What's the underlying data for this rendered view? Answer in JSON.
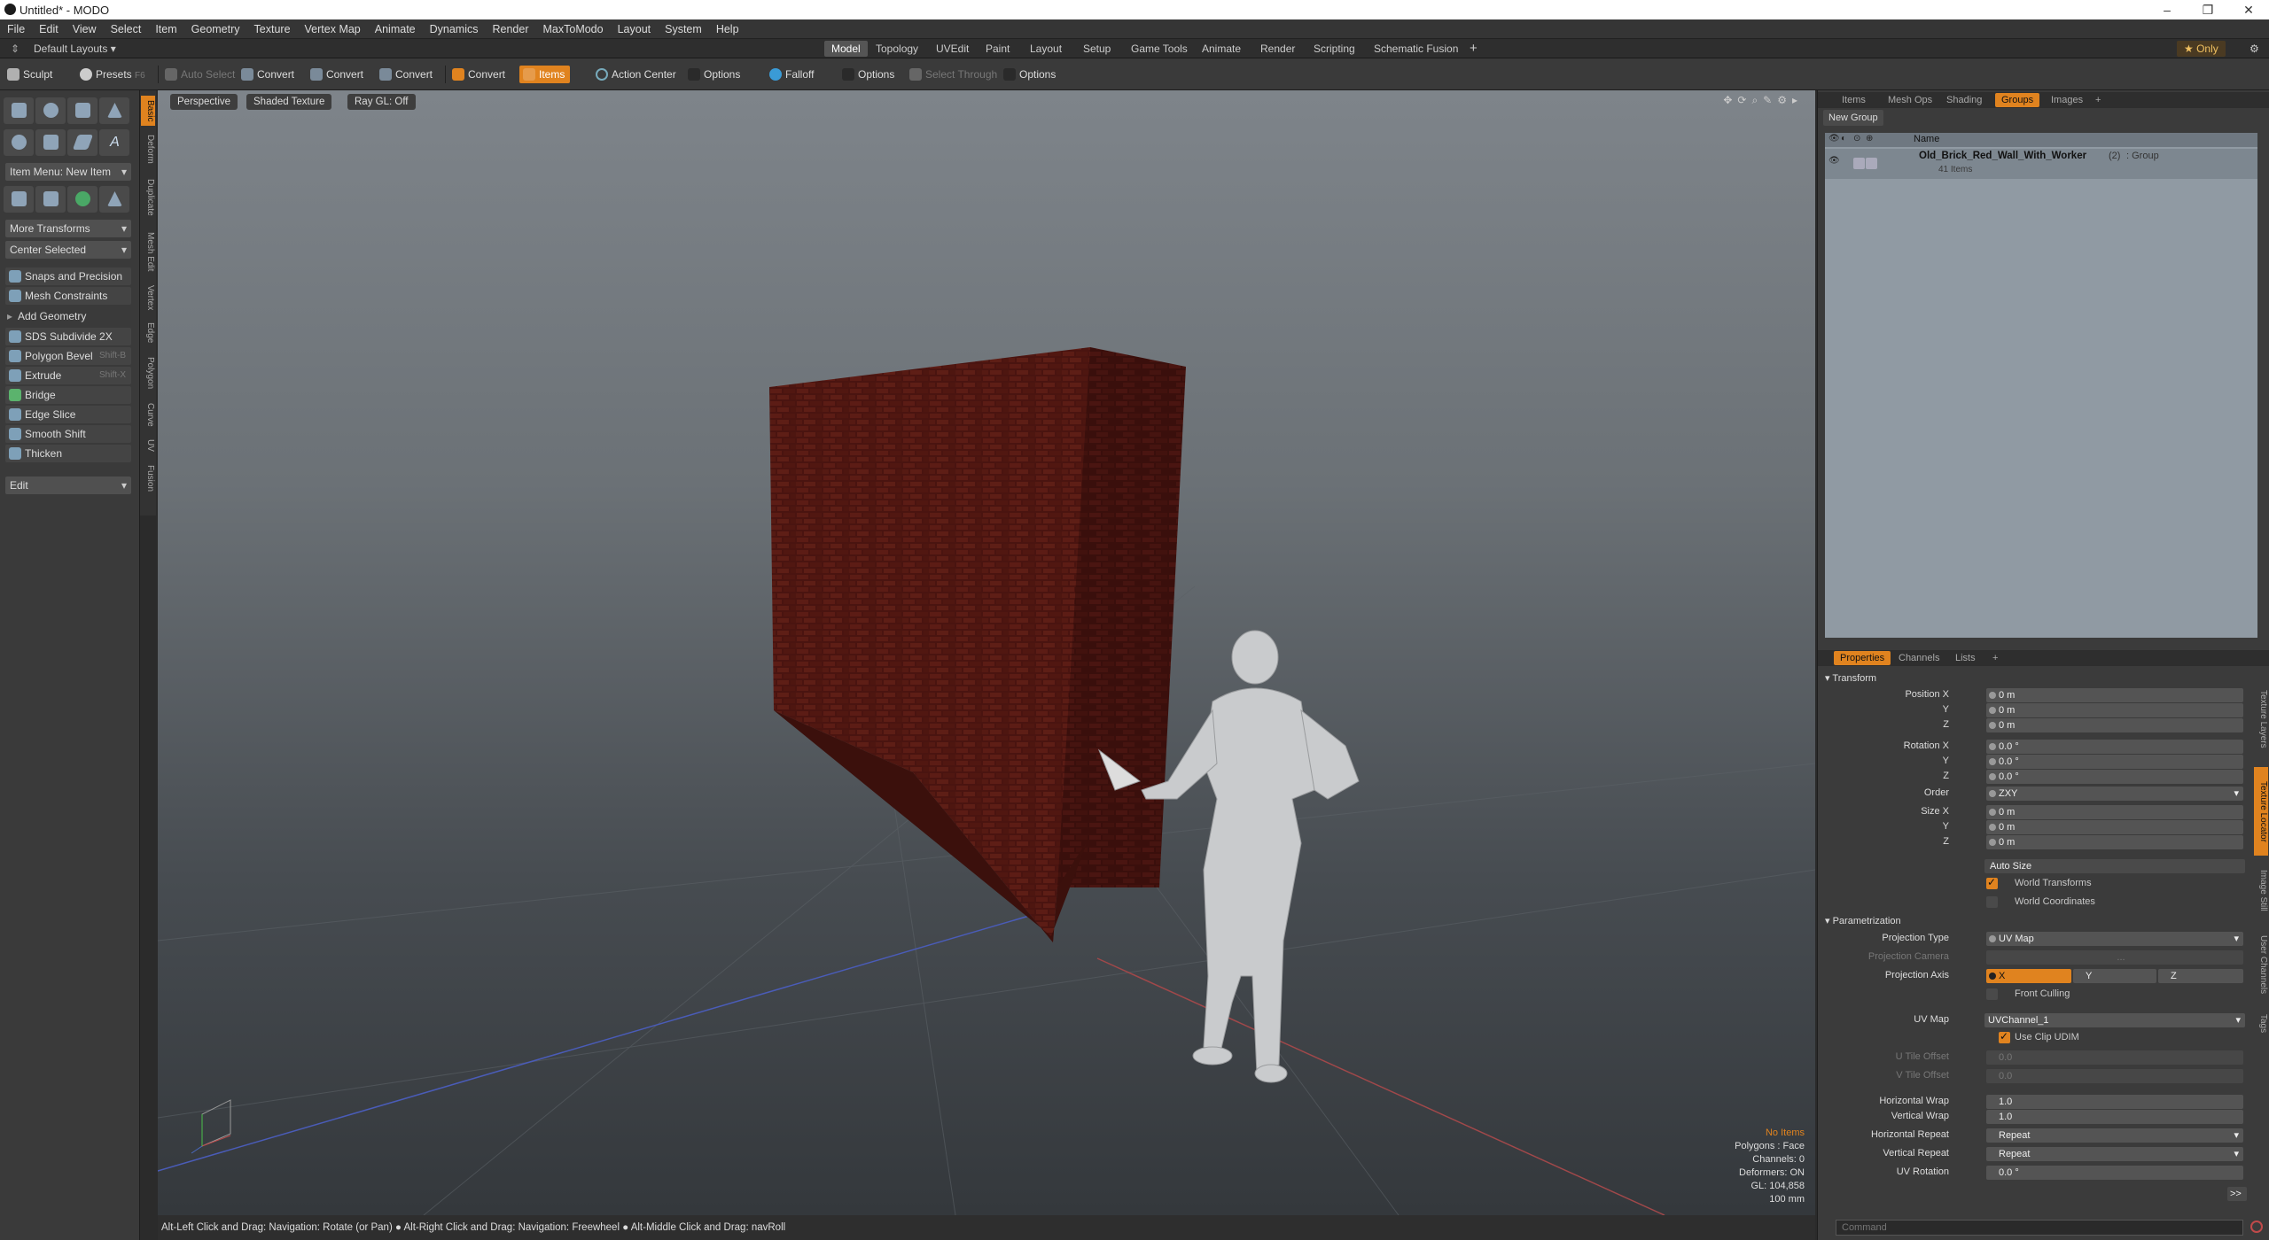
{
  "window": {
    "title": "Untitled* - MODO",
    "minimize": "–",
    "maximize": "❐",
    "close": "✕"
  },
  "menu": [
    "File",
    "Edit",
    "View",
    "Select",
    "Item",
    "Geometry",
    "Texture",
    "Vertex Map",
    "Animate",
    "Dynamics",
    "Render",
    "MaxToModo",
    "Layout",
    "System",
    "Help"
  ],
  "layoutbar": {
    "layouts_label": "Default Layouts ▾",
    "tabs": [
      "Model",
      "Topology",
      "UVEdit",
      "Paint",
      "Layout",
      "Setup",
      "Game Tools",
      "Animate",
      "Render",
      "Scripting",
      "Schematic Fusion"
    ],
    "add": "+",
    "only": "★ Only"
  },
  "toolbar": {
    "sculpt": "Sculpt",
    "presets": "Presets",
    "presets_key": "F6",
    "auto_select": "Auto Select",
    "convert": "Convert",
    "items": "Items",
    "action_center": "Action Center",
    "options": "Options",
    "falloff": "Falloff",
    "select_through": "Select Through"
  },
  "leftpanel": {
    "vtabs": [
      "Basic",
      "Deform",
      "Duplicate",
      "Mesh Edit",
      "Vertex",
      "Edge",
      "Polygon",
      "Curve",
      "UV",
      "Fusion"
    ],
    "item_menu": "Item Menu: New Item",
    "more_transforms": "More Transforms",
    "center_selected": "Center Selected",
    "snaps": "Snaps and Precision",
    "mesh_constraints": "Mesh Constraints",
    "add_geometry": "Add Geometry",
    "tools": [
      {
        "label": "SDS Subdivide 2X",
        "key": ""
      },
      {
        "label": "Polygon Bevel",
        "key": "Shift-B"
      },
      {
        "label": "Extrude",
        "key": "Shift-X"
      },
      {
        "label": "Bridge",
        "key": ""
      },
      {
        "label": "Edge Slice",
        "key": ""
      },
      {
        "label": "Smooth Shift",
        "key": ""
      },
      {
        "label": "Thicken",
        "key": ""
      }
    ],
    "edit": "Edit"
  },
  "viewport": {
    "perspective": "Perspective",
    "shading": "Shaded Texture",
    "raygl": "Ray GL: Off",
    "hud": {
      "items": "No Items",
      "polygons": "Polygons : Face",
      "channels": "Channels: 0",
      "deformers": "Deformers: ON",
      "gl": "GL: 104,858",
      "units": "100 mm"
    }
  },
  "status": "Alt-Left Click and Drag: Navigation: Rotate (or Pan) ● Alt-Right Click and Drag: Navigation: Freewheel ● Alt-Middle Click and Drag: navRoll",
  "rightpanel": {
    "top_tabs": [
      "Items",
      "Mesh Ops",
      "Shading",
      "Groups",
      "Images"
    ],
    "add": "+",
    "new_group": "New Group",
    "col_name": "Name",
    "group_name": "Old_Brick_Red_Wall_With_Worker",
    "group_count": "(2)",
    "group_type": ": Group",
    "group_items": "41 Items",
    "bottom_tabs": [
      "Properties",
      "Channels",
      "Lists"
    ],
    "side_tabs": [
      "Texture Layers",
      "Texture Locator",
      "Image Still",
      "User Channels",
      "Tags"
    ],
    "transform": {
      "title": "Transform",
      "position_x_label": "Position X",
      "position_x": "0 m",
      "position_y_label": "Y",
      "position_y": "0 m",
      "position_z_label": "Z",
      "position_z": "0 m",
      "rotation_x_label": "Rotation X",
      "rotation_x": "0.0 °",
      "rotation_y_label": "Y",
      "rotation_y": "0.0 °",
      "rotation_z_label": "Z",
      "rotation_z": "0.0 °",
      "order_label": "Order",
      "order": "ZXY",
      "size_x_label": "Size X",
      "size_x": "0 m",
      "size_y_label": "Y",
      "size_y": "0 m",
      "size_z_label": "Z",
      "size_z": "0 m",
      "auto_size": "Auto Size",
      "world_transforms": "World Transforms",
      "world_coordinates": "World Coordinates"
    },
    "param": {
      "title": "Parametrization",
      "projection_type_label": "Projection Type",
      "projection_type": "UV Map",
      "projection_camera_label": "Projection Camera",
      "projection_camera": "...",
      "projection_axis_label": "Projection Axis",
      "axis_x": "X",
      "axis_y": "Y",
      "axis_z": "Z",
      "front_culling": "Front Culling",
      "uv_map_label": "UV Map",
      "uv_map": "UVChannel_1",
      "use_clip_udim": "Use Clip UDIM",
      "u_tile_label": "U Tile Offset",
      "u_tile": "0.0",
      "v_tile_label": "V Tile Offset",
      "v_tile": "0.0",
      "h_wrap_label": "Horizontal Wrap",
      "h_wrap": "1.0",
      "v_wrap_label": "Vertical Wrap",
      "v_wrap": "1.0",
      "h_repeat_label": "Horizontal Repeat",
      "h_repeat": "Repeat",
      "v_repeat_label": "Vertical Repeat",
      "v_repeat": "Repeat",
      "uv_rot_label": "UV Rotation",
      "uv_rot": "0.0 °",
      "more": ">>"
    },
    "command_placeholder": "Command"
  },
  "colors": {
    "accent": "#e0831f",
    "brick": "#5a1a14"
  }
}
